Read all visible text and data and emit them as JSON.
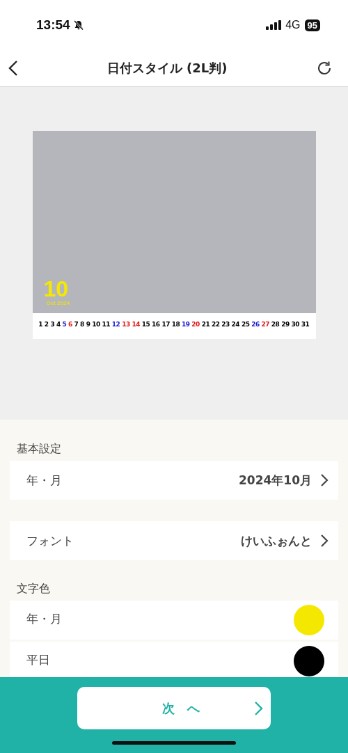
{
  "status_bar": {
    "time": "13:54",
    "network": "4G",
    "battery": "95"
  },
  "nav": {
    "title": "日付スタイル (2L判)"
  },
  "preview": {
    "month": "10",
    "month_caption": "Oct 2024",
    "days": [
      {
        "day": "1",
        "color": "#000000"
      },
      {
        "day": "2",
        "color": "#000000"
      },
      {
        "day": "3",
        "color": "#000000"
      },
      {
        "day": "4",
        "color": "#000000"
      },
      {
        "day": "5",
        "color": "#1a1ad0"
      },
      {
        "day": "6",
        "color": "#e01818"
      },
      {
        "day": "7",
        "color": "#000000"
      },
      {
        "day": "8",
        "color": "#000000"
      },
      {
        "day": "9",
        "color": "#000000"
      },
      {
        "day": "10",
        "color": "#000000"
      },
      {
        "day": "11",
        "color": "#000000"
      },
      {
        "day": "12",
        "color": "#1a1ad0"
      },
      {
        "day": "13",
        "color": "#e01818"
      },
      {
        "day": "14",
        "color": "#e01818"
      },
      {
        "day": "15",
        "color": "#000000"
      },
      {
        "day": "16",
        "color": "#000000"
      },
      {
        "day": "17",
        "color": "#000000"
      },
      {
        "day": "18",
        "color": "#000000"
      },
      {
        "day": "19",
        "color": "#1a1ad0"
      },
      {
        "day": "20",
        "color": "#e01818"
      },
      {
        "day": "21",
        "color": "#000000"
      },
      {
        "day": "22",
        "color": "#000000"
      },
      {
        "day": "23",
        "color": "#000000"
      },
      {
        "day": "24",
        "color": "#000000"
      },
      {
        "day": "25",
        "color": "#000000"
      },
      {
        "day": "26",
        "color": "#1a1ad0"
      },
      {
        "day": "27",
        "color": "#e01818"
      },
      {
        "day": "28",
        "color": "#000000"
      },
      {
        "day": "29",
        "color": "#000000"
      },
      {
        "day": "30",
        "color": "#000000"
      },
      {
        "day": "31",
        "color": "#000000"
      }
    ]
  },
  "sections": [
    {
      "title": "基本設定",
      "rows": [
        {
          "kind": "link",
          "label": "年・月",
          "value": "2024年10月"
        }
      ]
    },
    {
      "rows": [
        {
          "kind": "link",
          "label": "フォント",
          "value": "けいふぉんと"
        }
      ]
    },
    {
      "title": "文字色",
      "rows": [
        {
          "kind": "color",
          "label": "年・月",
          "color": "#f5e800"
        },
        {
          "kind": "color",
          "label": "平日",
          "color": "#000000"
        }
      ]
    }
  ],
  "next_button": {
    "label": "次　へ"
  }
}
